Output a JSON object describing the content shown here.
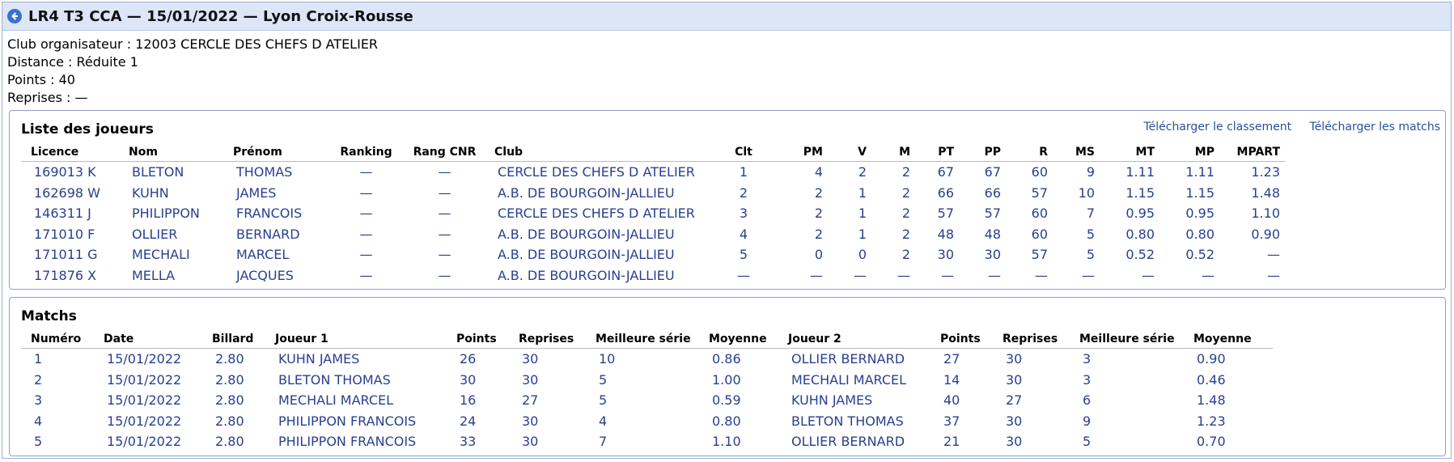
{
  "header": {
    "title": "LR4 T3 CCA — 15/01/2022 — Lyon Croix-Rousse"
  },
  "info": [
    "Club organisateur : 12003 CERCLE DES CHEFS D ATELIER",
    "Distance : Réduite 1",
    "Points : 40",
    "Reprises : —"
  ],
  "players": {
    "title": "Liste des joueurs",
    "download_ranking": "Télécharger le classement",
    "download_matches": "Télécharger les matchs",
    "columns": [
      "Licence",
      "Nom",
      "Prénom",
      "Ranking",
      "Rang CNR",
      "Club",
      "Clt",
      "PM",
      "V",
      "M",
      "PT",
      "PP",
      "R",
      "MS",
      "MT",
      "MP",
      "MPART"
    ],
    "rows": [
      [
        "169013 K",
        "BLETON",
        "THOMAS",
        "—",
        "—",
        "CERCLE DES CHEFS D ATELIER",
        "1",
        "4",
        "2",
        "2",
        "67",
        "67",
        "60",
        "9",
        "1.11",
        "1.11",
        "1.23"
      ],
      [
        "162698 W",
        "KUHN",
        "JAMES",
        "—",
        "—",
        "A.B. DE BOURGOIN-JALLIEU",
        "2",
        "2",
        "1",
        "2",
        "66",
        "66",
        "57",
        "10",
        "1.15",
        "1.15",
        "1.48"
      ],
      [
        "146311 J",
        "PHILIPPON",
        "FRANCOIS",
        "—",
        "—",
        "CERCLE DES CHEFS D ATELIER",
        "3",
        "2",
        "1",
        "2",
        "57",
        "57",
        "60",
        "7",
        "0.95",
        "0.95",
        "1.10"
      ],
      [
        "171010 F",
        "OLLIER",
        "BERNARD",
        "—",
        "—",
        "A.B. DE BOURGOIN-JALLIEU",
        "4",
        "2",
        "1",
        "2",
        "48",
        "48",
        "60",
        "5",
        "0.80",
        "0.80",
        "0.90"
      ],
      [
        "171011 G",
        "MECHALI",
        "MARCEL",
        "—",
        "—",
        "A.B. DE BOURGOIN-JALLIEU",
        "5",
        "0",
        "0",
        "2",
        "30",
        "30",
        "57",
        "5",
        "0.52",
        "0.52",
        "—"
      ],
      [
        "171876 X",
        "MELLA",
        "JACQUES",
        "—",
        "—",
        "A.B. DE BOURGOIN-JALLIEU",
        "—",
        "—",
        "—",
        "—",
        "—",
        "—",
        "—",
        "—",
        "—",
        "—",
        "—"
      ]
    ]
  },
  "matches": {
    "title": "Matchs",
    "columns": [
      "Numéro",
      "Date",
      "Billard",
      "Joueur 1",
      "Points",
      "Reprises",
      "Meilleure série",
      "Moyenne",
      "Joueur 2",
      "Points",
      "Reprises",
      "Meilleure série",
      "Moyenne"
    ],
    "rows": [
      [
        "1",
        "15/01/2022",
        "2.80",
        "KUHN JAMES",
        "26",
        "30",
        "10",
        "0.86",
        "OLLIER BERNARD",
        "27",
        "30",
        "3",
        "0.90"
      ],
      [
        "2",
        "15/01/2022",
        "2.80",
        "BLETON THOMAS",
        "30",
        "30",
        "5",
        "1.00",
        "MECHALI MARCEL",
        "14",
        "30",
        "3",
        "0.46"
      ],
      [
        "3",
        "15/01/2022",
        "2.80",
        "MECHALI MARCEL",
        "16",
        "27",
        "5",
        "0.59",
        "KUHN JAMES",
        "40",
        "27",
        "6",
        "1.48"
      ],
      [
        "4",
        "15/01/2022",
        "2.80",
        "PHILIPPON FRANCOIS",
        "24",
        "30",
        "4",
        "0.80",
        "BLETON THOMAS",
        "37",
        "30",
        "9",
        "1.23"
      ],
      [
        "5",
        "15/01/2022",
        "2.80",
        "PHILIPPON FRANCOIS",
        "33",
        "30",
        "7",
        "1.10",
        "OLLIER BERNARD",
        "21",
        "30",
        "5",
        "0.70"
      ]
    ]
  }
}
